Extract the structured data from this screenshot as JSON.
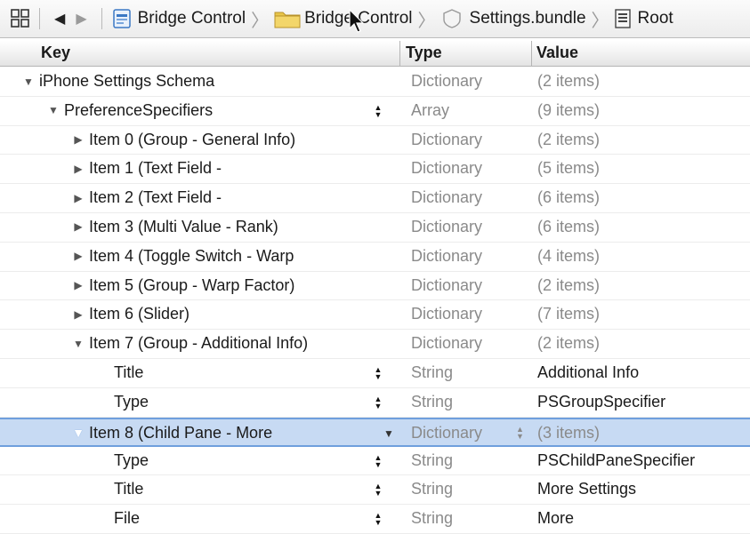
{
  "jumpbar": {
    "breadcrumbs": [
      {
        "label": "Bridge Control",
        "icon": "xcode-project-icon"
      },
      {
        "label": "Bridge Control",
        "icon": "folder-icon"
      },
      {
        "label": "Settings.bundle",
        "icon": "bundle-icon"
      },
      {
        "label": "Root",
        "icon": "plist-document-icon"
      }
    ]
  },
  "columns": {
    "key": "Key",
    "type": "Type",
    "value": "Value"
  },
  "rows": [
    {
      "key": "iPhone Settings Schema",
      "type": "Dictionary",
      "value": "(2 items)"
    },
    {
      "key": "PreferenceSpecifiers",
      "type": "Array",
      "value": "(9 items)"
    },
    {
      "key": "Item 0 (Group - General Info)",
      "type": "Dictionary",
      "value": "(2 items)"
    },
    {
      "key": "Item 1 (Text Field -",
      "type": "Dictionary",
      "value": "(5 items)"
    },
    {
      "key": "Item 2 (Text Field -",
      "type": "Dictionary",
      "value": "(6 items)"
    },
    {
      "key": "Item 3 (Multi Value - Rank)",
      "type": "Dictionary",
      "value": "(6 items)"
    },
    {
      "key": "Item 4 (Toggle Switch - Warp",
      "type": "Dictionary",
      "value": "(4 items)"
    },
    {
      "key": "Item 5 (Group - Warp Factor)",
      "type": "Dictionary",
      "value": "(2 items)"
    },
    {
      "key": "Item 6 (Slider)",
      "type": "Dictionary",
      "value": "(7 items)"
    },
    {
      "key": "Item 7 (Group - Additional Info)",
      "type": "Dictionary",
      "value": "(2 items)"
    },
    {
      "key": "Title",
      "type": "String",
      "value": "Additional Info"
    },
    {
      "key": "Type",
      "type": "String",
      "value": "PSGroupSpecifier"
    },
    {
      "key": "Item 8 (Child Pane - More",
      "type": "Dictionary",
      "value": "(3 items)"
    },
    {
      "key": "Type",
      "type": "String",
      "value": "PSChildPaneSpecifier"
    },
    {
      "key": "Title",
      "type": "String",
      "value": "More Settings"
    },
    {
      "key": "File",
      "type": "String",
      "value": "More"
    }
  ],
  "selected_row": "Item 8 (Child Pane - More"
}
